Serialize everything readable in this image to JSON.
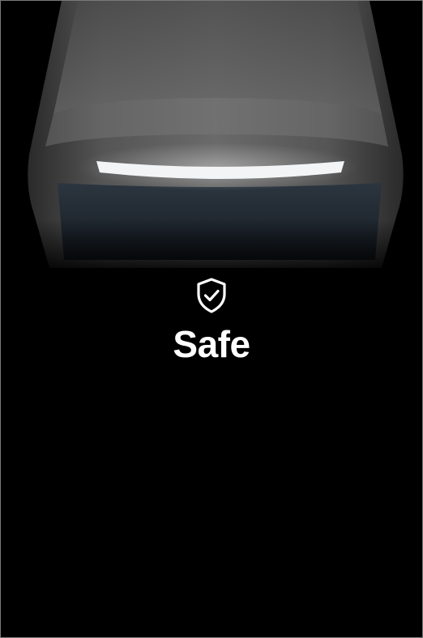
{
  "status": {
    "label": "Safe",
    "icon": "shield-check-icon",
    "text_color": "#ffffff"
  },
  "hero": {
    "icon": "device-light-illustration",
    "light_color": "#f2f4f6",
    "body_color": "#5c5c5c"
  }
}
